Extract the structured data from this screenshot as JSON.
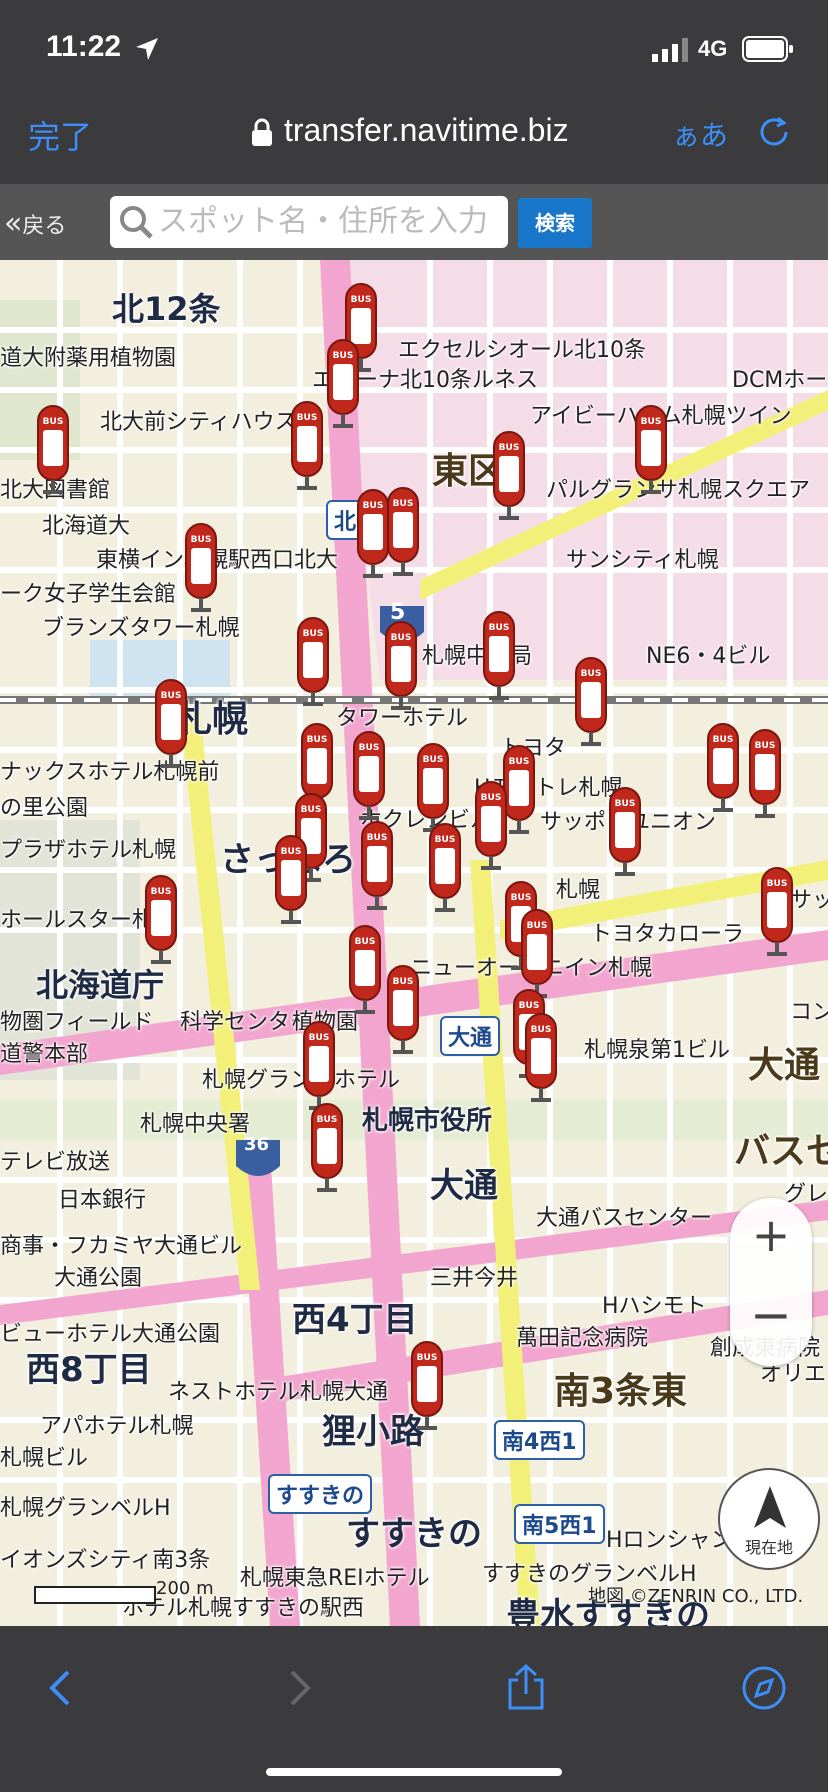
{
  "status_bar": {
    "time": "11:22",
    "network": "4G"
  },
  "browser": {
    "done_label": "完了",
    "url": "transfer.navitime.biz",
    "text_size_label": "ぁあ"
  },
  "search": {
    "back_label": "戻る",
    "placeholder": "スポット名・住所を入力",
    "button_label": "検索"
  },
  "map": {
    "districts": [
      "北12条",
      "東区",
      "札幌",
      "さっぽろ",
      "大通",
      "西4丁目",
      "西8丁目",
      "狸小路",
      "すすきの",
      "南3条東",
      "北海道庁",
      "バスセ",
      "大通"
    ],
    "labels": [
      "エクセルシオール北10条",
      "エナーナ北10条ルネス",
      "DCMホー",
      "北大前シティハウス",
      "アイビーハイム札幌ツイン",
      "道大附薬用植物園",
      "北大図書館",
      "北海道大",
      "東横イン札幌駅西口北大",
      "パルグランサ札幌スクエア",
      "サンシティ札幌",
      "ーク女子学生会館",
      "ブランズタワー札幌",
      "札幌中央局",
      "NE6・4ビル",
      "タワーホテル",
      "トヨタ",
      "Hモントレ札幌",
      "ナックスホテル札幌前",
      "の里公園",
      "プラザホテル札幌",
      "ホクレンビル",
      "サッポロユニオン",
      "札幌",
      "ホールスター札幌",
      "トヨタカローラ",
      "ニューオータニイン札幌",
      "物圏フィールド",
      "科学センター",
      "植物園",
      "道警本部",
      "札幌グランドホテル",
      "札幌泉第1ビル",
      "札幌中央署",
      "札幌市役所",
      "テレビ放送",
      "日本銀行",
      "大通バスセンター",
      "グレ",
      "商事・フカミヤ大通ビル",
      "大通公園",
      "三井今井",
      "Hハシモト",
      "ビューホテル大通公園",
      "萬田記念病院",
      "創成東病院",
      "オリエ",
      "ネストホテル札幌大通",
      "アパホテル札幌",
      "札幌ビル",
      "札幌グランベルH",
      "イオンズシティ南3条",
      "札幌東急REIホテル",
      "Hロンシャン",
      "すすきのグランベルH",
      "ホテル札幌すすきの駅西",
      "豊水すすきの",
      "サッ",
      "コン"
    ],
    "stations": [
      "北7西1",
      "大通",
      "南4西1",
      "南5西1",
      "すすきの"
    ],
    "route_numbers": [
      "5",
      "36"
    ],
    "poi_icons": [
      "bus-stop-icon",
      "convenience-store-icon",
      "24h-icon",
      "parking-icon",
      "hotel-icon",
      "subway-icon"
    ],
    "scale_label": "200 m",
    "copyright": "地図 ©ZENRIN CO., LTD.",
    "current_location_label": "現在地",
    "bus_label": "BUS"
  },
  "colors": {
    "accent": "#3d8ef6",
    "bar_bg": "#3b3b3d",
    "search_btn": "#1977c9",
    "bus_red": "#c0281c",
    "main_road": "#f2a6cf",
    "arterial": "#f3f07a"
  }
}
